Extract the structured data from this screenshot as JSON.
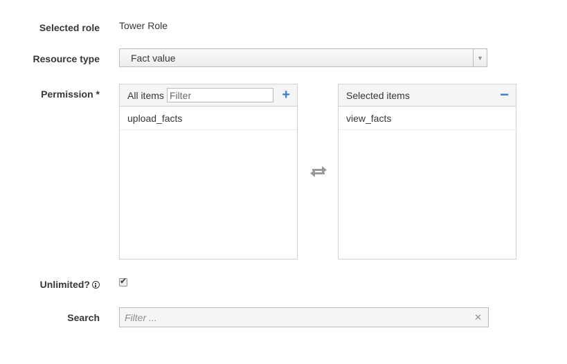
{
  "form": {
    "selected_role_label": "Selected role",
    "selected_role_value": "Tower Role",
    "resource_type_label": "Resource type",
    "resource_type_value": "Fact value",
    "permission_label": "Permission *",
    "unlimited_label": "Unlimited?",
    "unlimited_checked": true,
    "search_label": "Search",
    "search_placeholder": "Filter ..."
  },
  "all_items": {
    "header": "All items",
    "filter_placeholder": "Filter",
    "items": [
      "upload_facts"
    ]
  },
  "selected_items": {
    "header": "Selected items",
    "items": [
      "view_facts"
    ]
  },
  "icons": {
    "add": "plus-icon",
    "remove": "minus-icon",
    "swap": "swap-arrows-icon",
    "info": "info-icon",
    "clear": "clear-icon",
    "caret": "caret-down-icon"
  },
  "colors": {
    "accent": "#3d7cc9",
    "border": "#bbbbbb"
  }
}
